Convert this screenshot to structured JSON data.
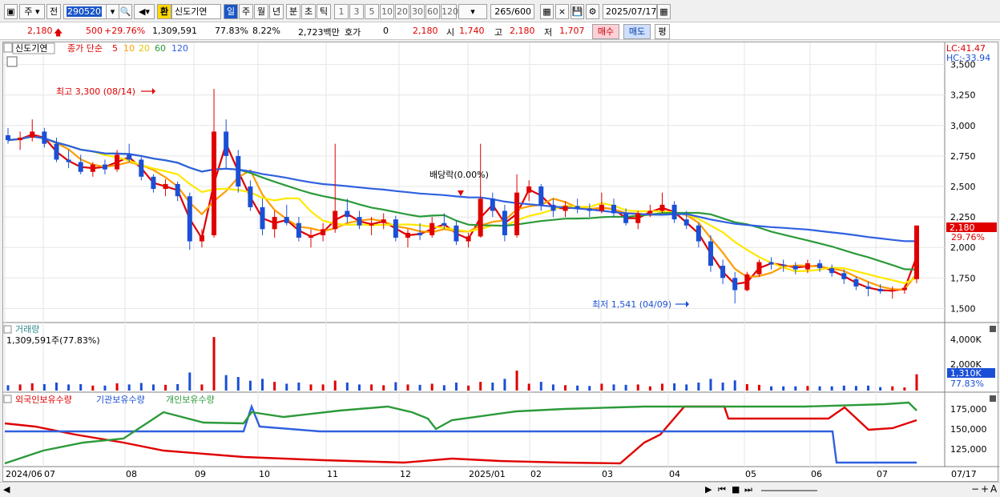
{
  "toolbar": {
    "menu_icon": "layout-icon",
    "market_label": "주",
    "all_label": "전",
    "stock_code": "290520",
    "exchange_label": "환",
    "stock_name": "신도기연",
    "period_tabs": [
      "일",
      "주",
      "월",
      "년",
      "분",
      "초",
      "틱"
    ],
    "active_period": "일",
    "interval_buttons": [
      "1",
      "3",
      "5",
      "10",
      "20",
      "30",
      "60",
      "120"
    ],
    "count_value": "265",
    "count_total": "/600",
    "date_value": "2025/07/17"
  },
  "pricebar": {
    "price": "2,180",
    "change": "500",
    "change_pct": "+29.76%",
    "volume": "1,309,591",
    "turnover_pct": "77.83%",
    "ratio": "8.22%",
    "amount": "2,723백만",
    "quote_label": "호가",
    "quote_value": "0",
    "cur_price": "2,180",
    "open_label": "시",
    "open_value": "1,740",
    "high_label": "고",
    "high_value": "2,180",
    "low_label": "저",
    "low_value": "1,707",
    "buy_label": "매수",
    "sell_label": "매도",
    "eval_label": "평"
  },
  "chart": {
    "stock_tag": "신도기연",
    "legend_close": "종가 단순",
    "ma_periods": [
      "5",
      "10",
      "20",
      "60",
      "120"
    ],
    "ma_colors": [
      "#e00000",
      "#ff9d00",
      "#ffe800",
      "#2c9a3a",
      "#3060e0"
    ],
    "lc_label": "LC:41.47",
    "hc_label": "HC:-33.94",
    "price_ticks": [
      "3,500",
      "3,250",
      "3,000",
      "2,750",
      "2,500",
      "2,250",
      "2,000",
      "1,750",
      "1,500"
    ],
    "current_price_tag": "2,180",
    "current_pct_tag": "29.76%",
    "high_note": "최고 3,300 (08/14)",
    "low_note": "최저 1,541 (04/09)",
    "dividend_note": "배당락(0.00%)",
    "volume_title": "거래량",
    "volume_value": "1,309,591주(77.83%)",
    "volume_ticks": [
      "4,000K",
      "2,000K"
    ],
    "volume_tag": "1,310K",
    "volume_pct_tag": "77.83%",
    "holdings_legend": [
      "외국인보유수량",
      "기관보유수량",
      "개인보유수량"
    ],
    "holdings_colors": [
      "#e00000",
      "#3060e0",
      "#2c9a3a"
    ],
    "holdings_ticks": [
      "175,000",
      "150,000",
      "125,000"
    ],
    "x_labels": [
      "2024/06",
      "07",
      "08",
      "09",
      "10",
      "11",
      "12",
      "2025/01",
      "02",
      "03",
      "04",
      "05",
      "06",
      "07"
    ],
    "x_end_label": "07/17",
    "up_color": "#e00000",
    "down_color": "#1a4fd6"
  },
  "chart_data": {
    "type": "candlestick",
    "title": "신도기연",
    "ylim": [
      1450,
      3550
    ],
    "candles": [
      [
        2920,
        2980,
        2850,
        2880
      ],
      [
        2880,
        2950,
        2800,
        2900
      ],
      [
        2900,
        3050,
        2870,
        2950
      ],
      [
        2950,
        2980,
        2820,
        2850
      ],
      [
        2850,
        2900,
        2700,
        2720
      ],
      [
        2720,
        2800,
        2650,
        2700
      ],
      [
        2700,
        2760,
        2600,
        2620
      ],
      [
        2620,
        2700,
        2580,
        2680
      ],
      [
        2680,
        2720,
        2600,
        2640
      ],
      [
        2640,
        2800,
        2620,
        2760
      ],
      [
        2760,
        2850,
        2700,
        2720
      ],
      [
        2720,
        2740,
        2550,
        2580
      ],
      [
        2580,
        2600,
        2450,
        2480
      ],
      [
        2480,
        2560,
        2420,
        2520
      ],
      [
        2520,
        2540,
        2380,
        2420
      ],
      [
        2420,
        2450,
        1980,
        2050
      ],
      [
        2050,
        2150,
        2000,
        2100
      ],
      [
        2100,
        3300,
        2080,
        2950
      ],
      [
        2950,
        3050,
        2650,
        2750
      ],
      [
        2750,
        2800,
        2450,
        2500
      ],
      [
        2500,
        2550,
        2300,
        2330
      ],
      [
        2330,
        2400,
        2100,
        2150
      ],
      [
        2150,
        2300,
        2080,
        2250
      ],
      [
        2250,
        2350,
        2180,
        2200
      ],
      [
        2200,
        2250,
        2050,
        2080
      ],
      [
        2080,
        2150,
        2000,
        2100
      ],
      [
        2100,
        2200,
        2050,
        2150
      ],
      [
        2150,
        2850,
        2120,
        2300
      ],
      [
        2300,
        2400,
        2200,
        2250
      ],
      [
        2250,
        2300,
        2150,
        2180
      ],
      [
        2180,
        2250,
        2100,
        2200
      ],
      [
        2200,
        2280,
        2150,
        2230
      ],
      [
        2230,
        2260,
        2050,
        2080
      ],
      [
        2080,
        2150,
        2000,
        2120
      ],
      [
        2120,
        2200,
        2060,
        2100
      ],
      [
        2100,
        2250,
        2080,
        2200
      ],
      [
        2200,
        2280,
        2150,
        2180
      ],
      [
        2180,
        2220,
        2020,
        2050
      ],
      [
        2050,
        2120,
        2000,
        2090
      ],
      [
        2090,
        2850,
        2080,
        2400
      ],
      [
        2400,
        2450,
        2250,
        2300
      ],
      [
        2300,
        2350,
        2050,
        2100
      ],
      [
        2100,
        2600,
        2080,
        2450
      ],
      [
        2450,
        2550,
        2380,
        2500
      ],
      [
        2500,
        2520,
        2300,
        2350
      ],
      [
        2350,
        2400,
        2250,
        2300
      ],
      [
        2300,
        2380,
        2250,
        2340
      ],
      [
        2340,
        2400,
        2280,
        2320
      ],
      [
        2320,
        2360,
        2250,
        2300
      ],
      [
        2300,
        2450,
        2280,
        2350
      ],
      [
        2350,
        2400,
        2250,
        2280
      ],
      [
        2280,
        2320,
        2180,
        2200
      ],
      [
        2200,
        2300,
        2150,
        2280
      ],
      [
        2280,
        2350,
        2250,
        2300
      ],
      [
        2300,
        2450,
        2280,
        2350
      ],
      [
        2350,
        2380,
        2200,
        2230
      ],
      [
        2230,
        2300,
        2150,
        2180
      ],
      [
        2180,
        2200,
        2000,
        2050
      ],
      [
        2050,
        2100,
        1800,
        1850
      ],
      [
        1850,
        1900,
        1700,
        1750
      ],
      [
        1750,
        1800,
        1541,
        1650
      ],
      [
        1650,
        1800,
        1640,
        1780
      ],
      [
        1780,
        1900,
        1760,
        1880
      ],
      [
        1880,
        1920,
        1820,
        1860
      ],
      [
        1860,
        1900,
        1800,
        1850
      ],
      [
        1850,
        1880,
        1780,
        1820
      ],
      [
        1820,
        1900,
        1790,
        1870
      ],
      [
        1870,
        1900,
        1800,
        1830
      ],
      [
        1830,
        1860,
        1760,
        1790
      ],
      [
        1790,
        1820,
        1700,
        1740
      ],
      [
        1740,
        1760,
        1650,
        1680
      ],
      [
        1680,
        1720,
        1600,
        1660
      ],
      [
        1660,
        1700,
        1620,
        1640
      ],
      [
        1640,
        1680,
        1580,
        1650
      ],
      [
        1650,
        1690,
        1620,
        1670
      ],
      [
        1740,
        2180,
        1707,
        2180
      ]
    ]
  }
}
